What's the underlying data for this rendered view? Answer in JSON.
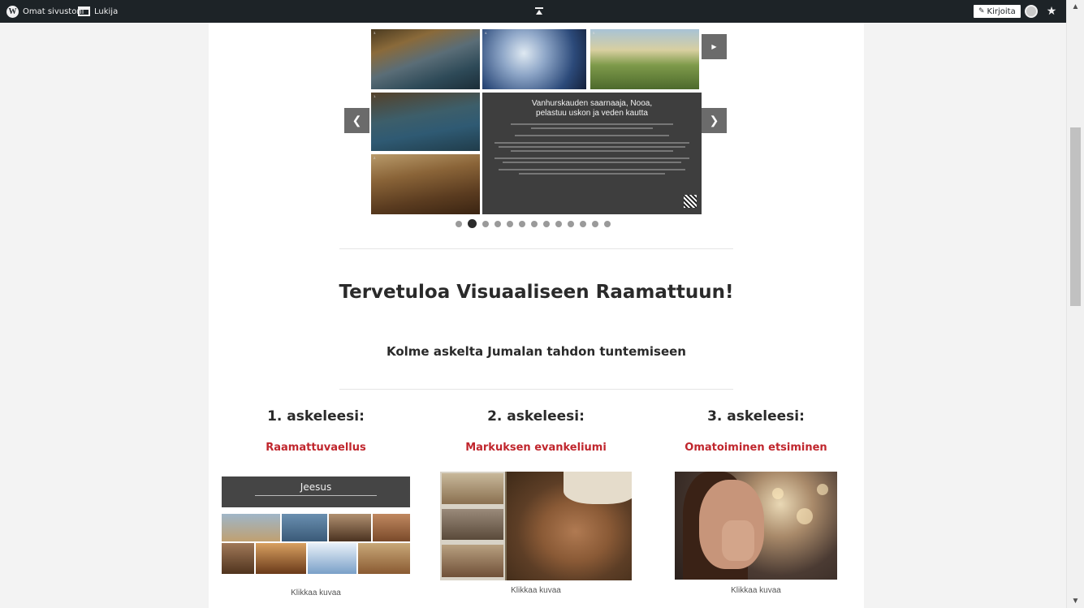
{
  "adminbar": {
    "my_sites": "Omat sivustoni",
    "reader": "Lukija",
    "write": "Kirjoita"
  },
  "slider": {
    "tile_numbers": [
      "3.",
      "4.",
      "5.",
      "1.",
      "2."
    ],
    "panel_title": "Vanhurskauden saarnaaja, Nooa,\npelastuu uskon ja veden kautta",
    "dot_count": 13,
    "active_dot": 1
  },
  "welcome": {
    "title": "Tervetuloa Visuaaliseen Raamattuun!",
    "subtitle": "Kolme askelta Jumalan tahdon tuntemiseen"
  },
  "steps": [
    {
      "heading": "1. askeleesi:",
      "link": "Raamattuvaellus",
      "caption": "Klikkaa kuvaa",
      "image_text": "Jeesus"
    },
    {
      "heading": "2. askeleesi:",
      "link": "Markuksen evankeliumi",
      "caption": "Klikkaa kuvaa"
    },
    {
      "heading": "3. askeleesi:",
      "link": "Omatoiminen etsiminen",
      "caption": "Klikkaa kuvaa"
    }
  ],
  "colors": {
    "adminbar": "#1d2327",
    "link_red": "#c0262d",
    "text_dark": "#2a2a2a"
  }
}
